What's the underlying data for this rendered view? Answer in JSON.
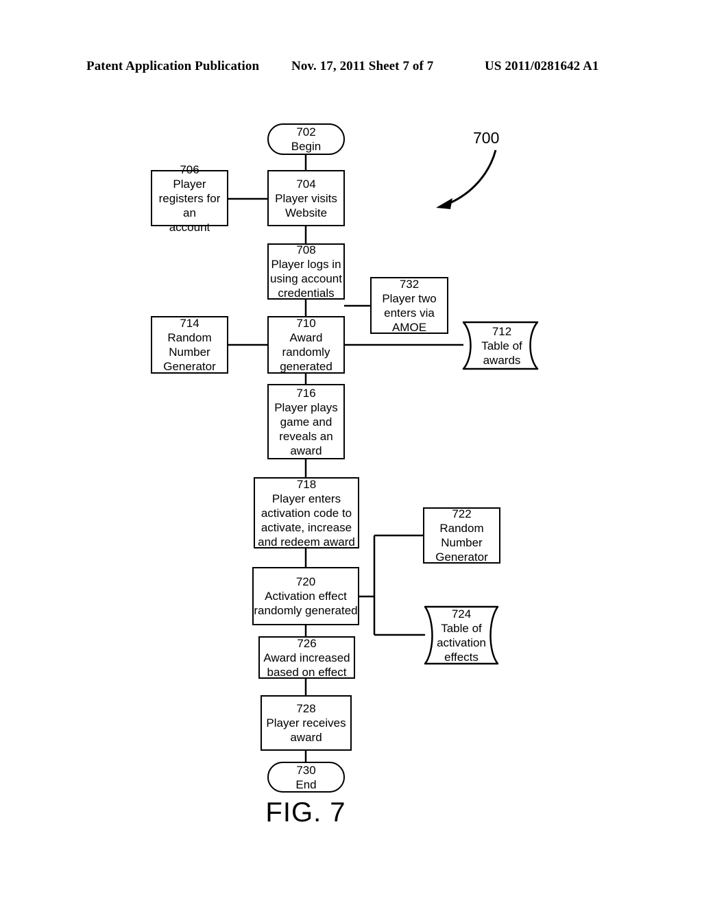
{
  "header": {
    "left": "Patent Application Publication",
    "middle": "Nov. 17, 2011  Sheet 7 of 7",
    "right": "US 2011/0281642 A1"
  },
  "figure": {
    "caption": "FIG. 7",
    "reference_label": "700"
  },
  "nodes": {
    "n702": {
      "num": "702",
      "text": "Begin",
      "shape": "terminal"
    },
    "n704": {
      "num": "704",
      "text": "Player visits\nWebsite",
      "shape": "process"
    },
    "n706": {
      "num": "706",
      "text": "Player\nregisters for an\naccount",
      "shape": "process"
    },
    "n708": {
      "num": "708",
      "text": "Player logs in\nusing account\ncredentials",
      "shape": "process"
    },
    "n710": {
      "num": "710",
      "text": "Award\nrandomly\ngenerated",
      "shape": "process"
    },
    "n712": {
      "num": "712",
      "text": "Table of\nawards",
      "shape": "document"
    },
    "n714": {
      "num": "714",
      "text": "Random\nNumber\nGenerator",
      "shape": "process"
    },
    "n716": {
      "num": "716",
      "text": "Player plays\ngame and\nreveals an\naward",
      "shape": "process"
    },
    "n718": {
      "num": "718",
      "text": "Player enters\nactivation code to\nactivate, increase\nand redeem award",
      "shape": "process"
    },
    "n720": {
      "num": "720",
      "text": "Activation effect\nrandomly generated",
      "shape": "process"
    },
    "n722": {
      "num": "722",
      "text": "Random\nNumber\nGenerator",
      "shape": "process"
    },
    "n724": {
      "num": "724",
      "text": "Table of\nactivation\neffects",
      "shape": "document"
    },
    "n726": {
      "num": "726",
      "text": "Award increased\nbased on effect",
      "shape": "process"
    },
    "n728": {
      "num": "728",
      "text": "Player receives\naward",
      "shape": "process"
    },
    "n730": {
      "num": "730",
      "text": "End",
      "shape": "terminal"
    },
    "n732": {
      "num": "732",
      "text": "Player two\nenters via\nAMOE",
      "shape": "process"
    }
  },
  "colors": {
    "stroke": "#000000",
    "fill": "#ffffff",
    "background": "#ffffff"
  }
}
